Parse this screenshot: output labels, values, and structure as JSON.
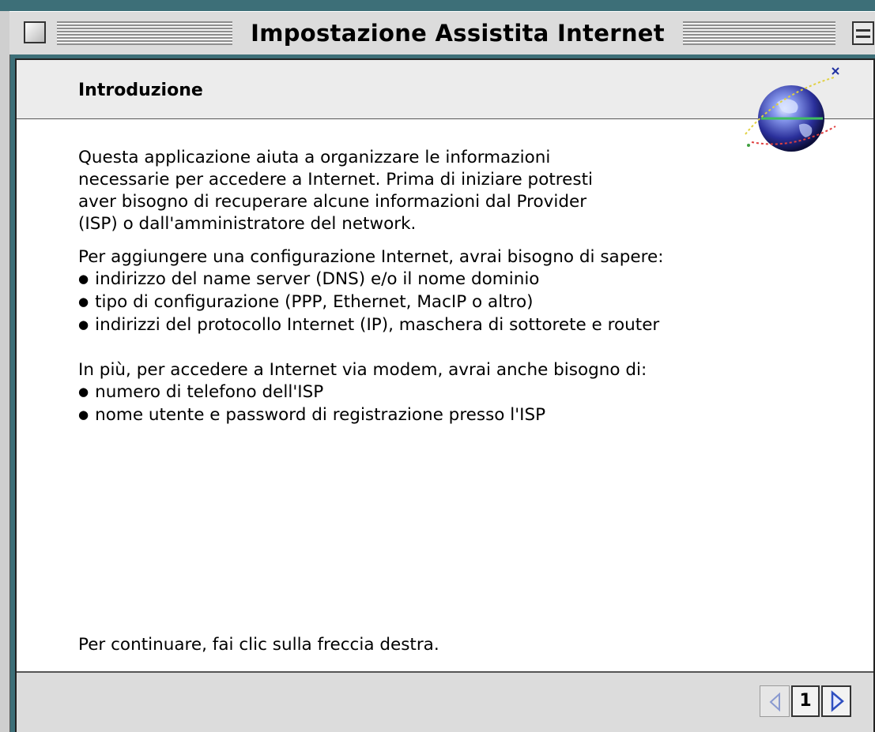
{
  "window": {
    "title": "Impostazione Assistita Internet"
  },
  "header": {
    "title": "Introduzione",
    "icon": "globe-icon"
  },
  "body": {
    "intro_lines": [
      "Questa applicazione aiuta a organizzare le informazioni",
      "necessarie per accedere a Internet. Prima di iniziare potresti",
      "aver bisogno di recuperare alcune informazioni dal Provider",
      "(ISP) o dall'amministratore del network."
    ],
    "config_heading": "Per aggiungere una configurazione Internet, avrai bisogno di sapere:",
    "config_items": [
      "indirizzo del name server (DNS) e/o il nome dominio",
      "tipo di configurazione (PPP, Ethernet, MacIP o altro)",
      "indirizzi del protocollo Internet (IP), maschera di sottorete e router"
    ],
    "modem_heading": "In più, per accedere a Internet via modem, avrai anche bisogno di:",
    "modem_items": [
      "numero di telefono dell'ISP",
      "nome utente e password di registrazione presso l'ISP"
    ],
    "footer_instruction": "Per continuare, fai clic sulla freccia destra."
  },
  "navigation": {
    "page_number": "1",
    "prev_icon": "left-arrow-icon",
    "next_icon": "right-arrow-icon"
  },
  "colors": {
    "desktop": "#3d6f78",
    "accent_arrow": "#2f4fc0"
  }
}
